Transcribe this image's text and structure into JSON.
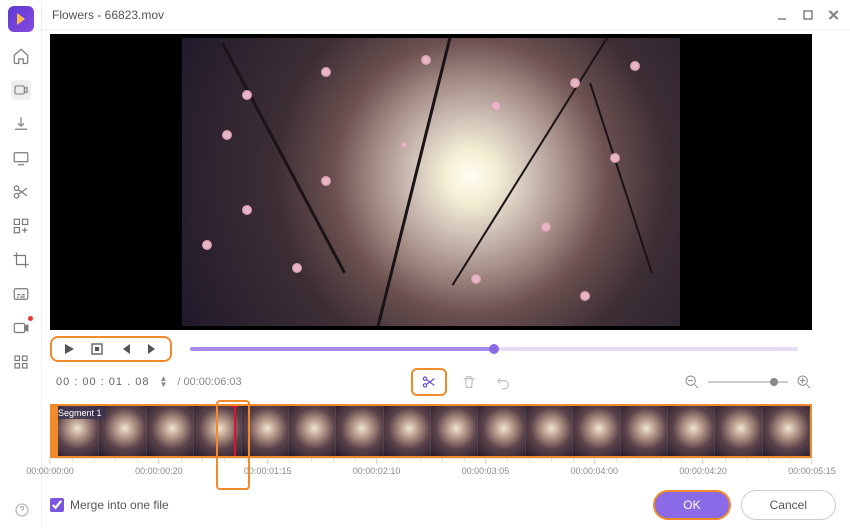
{
  "window": {
    "title": "Flowers - 66823.mov"
  },
  "playback": {
    "current_time": "00 : 00 : 01 . 08",
    "total_time": "00:00:06:03"
  },
  "timeline": {
    "segment_label": "Segment 1",
    "ticks": [
      "00:00:00:00",
      "00:00:00:20",
      "00:00:01:15",
      "00:00:02:10",
      "00:00:03:05",
      "00:00:04:00",
      "00:00:04:20",
      "00:00:05:15"
    ]
  },
  "footer": {
    "merge_label": "Merge into one file",
    "ok_label": "OK",
    "cancel_label": "Cancel"
  }
}
